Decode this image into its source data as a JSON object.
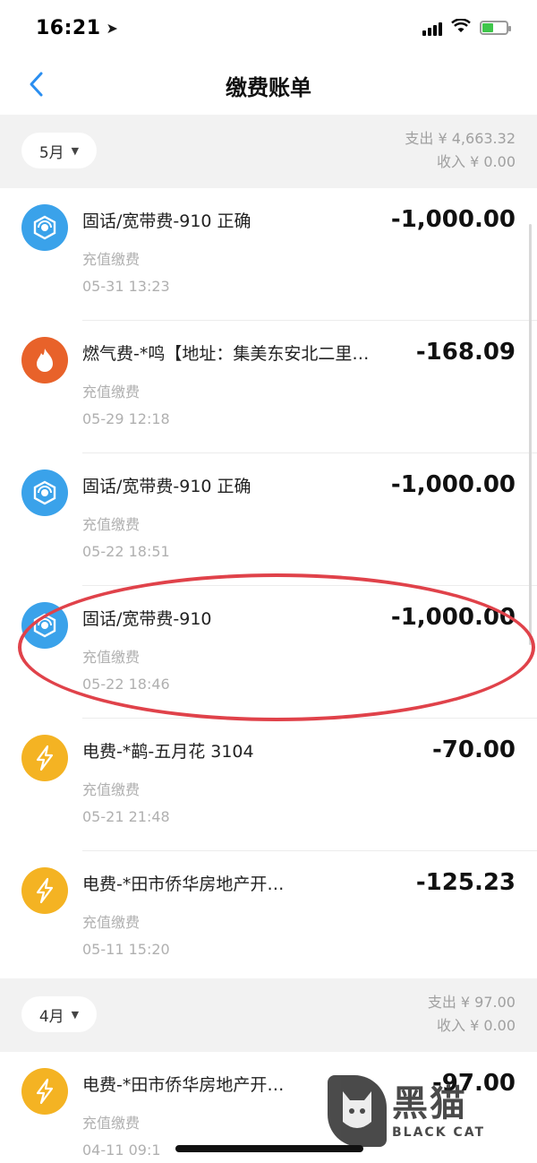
{
  "status_bar": {
    "time": "16:21",
    "location_icon": "location-arrow-icon"
  },
  "nav": {
    "back_icon": "chevron-left-icon",
    "title": "缴费账单"
  },
  "months": [
    {
      "label": "5月",
      "expense": "支出 ¥ 4,663.32",
      "income": "收入 ¥ 0.00"
    },
    {
      "label": "4月",
      "expense": "支出 ¥ 97.00",
      "income": "收入 ¥ 0.00"
    }
  ],
  "items": [
    {
      "icon": "landline-icon",
      "color": "#3aa2ea",
      "title": "固话/宽带费-910 正确",
      "subtitle": "充值缴费",
      "time": "05-31  13:23",
      "amount": "-1,000.00"
    },
    {
      "icon": "flame-icon",
      "color": "#e8622a",
      "title": "燃气费-*鸣【地址：集美东安北二里…",
      "subtitle": "充值缴费",
      "time": "05-29  12:18",
      "amount": "-168.09"
    },
    {
      "icon": "landline-icon",
      "color": "#3aa2ea",
      "title": "固话/宽带费-910 正确",
      "subtitle": "充值缴费",
      "time": "05-22  18:51",
      "amount": "-1,000.00"
    },
    {
      "icon": "landline-icon",
      "color": "#3aa2ea",
      "title": "固话/宽带费-910",
      "subtitle": "充值缴费",
      "time": "05-22  18:46",
      "amount": "-1,000.00"
    },
    {
      "icon": "lightning-icon",
      "color": "#f4b323",
      "title": "电费-*鹋-五月花 3104",
      "subtitle": "充值缴费",
      "time": "05-21  21:48",
      "amount": "-70.00"
    },
    {
      "icon": "lightning-icon",
      "color": "#f4b323",
      "title": "电费-*田市侨华房地产开…",
      "subtitle": "充值缴费",
      "time": "05-11  15:20",
      "amount": "-125.23"
    },
    {
      "icon": "lightning-icon",
      "color": "#f4b323",
      "title": "电费-*田市侨华房地产开…",
      "subtitle": "充值缴费",
      "time": "04-11  09:1",
      "amount": "-97.00"
    }
  ],
  "watermark": {
    "cn": "黑猫",
    "en": "BLACK CAT"
  },
  "colors": {
    "accent": "#2a8ef0",
    "annotation": "#e0424a"
  }
}
